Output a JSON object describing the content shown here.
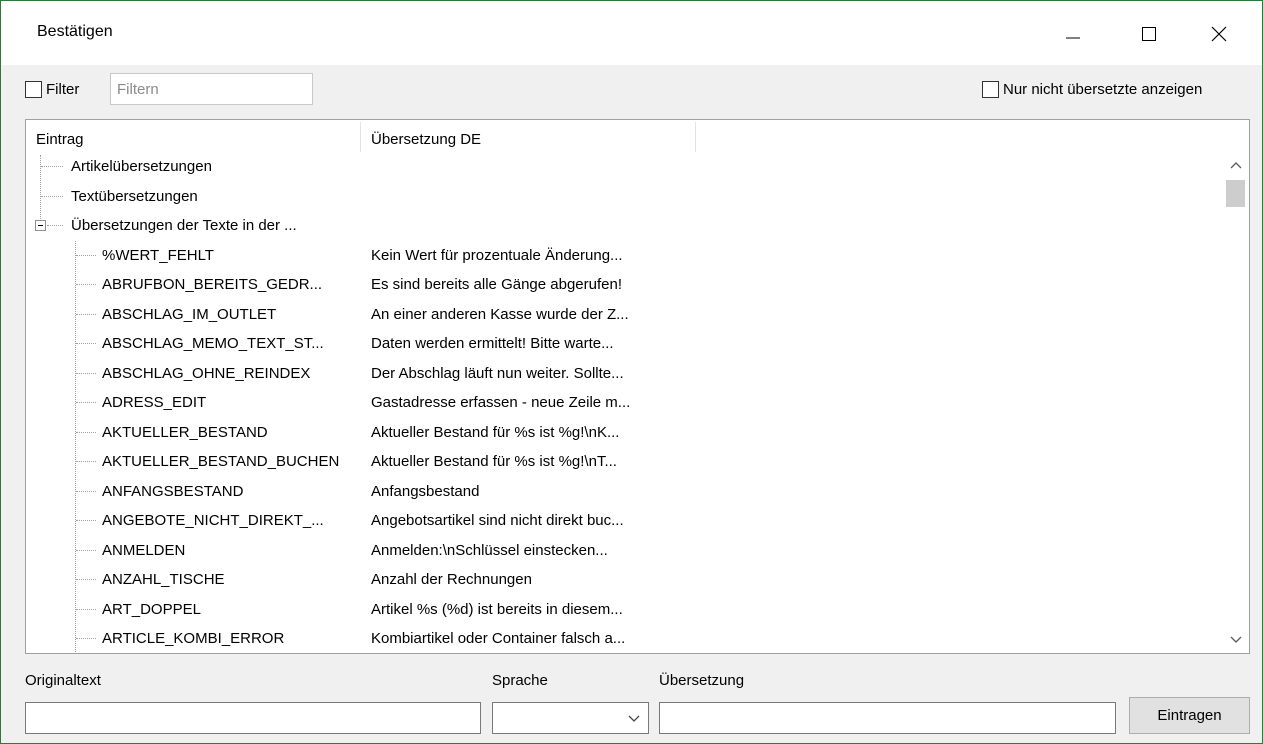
{
  "window": {
    "title": "Bestätigen"
  },
  "filter": {
    "checkbox_label": "Filter",
    "input_placeholder": "Filtern",
    "input_value": "",
    "untranslated_label": "Nur nicht übersetzte anzeigen"
  },
  "tree": {
    "columns": [
      "Eintrag",
      "Übersetzung DE"
    ],
    "groups": [
      {
        "label": "Artikelübersetzungen"
      },
      {
        "label": "Textübersetzungen"
      },
      {
        "label": "Übersetzungen der Texte in der ...",
        "expanded": true
      }
    ],
    "entries": [
      {
        "key": "%WERT_FEHLT",
        "value": "Kein Wert für prozentuale Änderung..."
      },
      {
        "key": "ABRUFBON_BEREITS_GEDR...",
        "value": "Es sind bereits alle Gänge abgerufen!"
      },
      {
        "key": "ABSCHLAG_IM_OUTLET",
        "value": "An einer anderen Kasse wurde der Z..."
      },
      {
        "key": "ABSCHLAG_MEMO_TEXT_ST...",
        "value": "Daten werden ermittelt! Bitte warte..."
      },
      {
        "key": "ABSCHLAG_OHNE_REINDEX",
        "value": "Der Abschlag läuft nun weiter. Sollte..."
      },
      {
        "key": "ADRESS_EDIT",
        "value": "Gastadresse erfassen - neue Zeile m..."
      },
      {
        "key": "AKTUELLER_BESTAND",
        "value": "Aktueller Bestand für %s ist %g!\\nK..."
      },
      {
        "key": "AKTUELLER_BESTAND_BUCHEN",
        "value": "Aktueller Bestand für %s ist %g!\\nT..."
      },
      {
        "key": "ANFANGSBESTAND",
        "value": "Anfangsbestand"
      },
      {
        "key": "ANGEBOTE_NICHT_DIREKT_...",
        "value": "Angebotsartikel sind nicht direkt buc..."
      },
      {
        "key": "ANMELDEN",
        "value": "Anmelden:\\nSchlüssel einstecken..."
      },
      {
        "key": "ANZAHL_TISCHE",
        "value": "Anzahl der Rechnungen"
      },
      {
        "key": "ART_DOPPEL",
        "value": "Artikel %s (%d) ist bereits in diesem..."
      },
      {
        "key": "ARTICLE_KOMBI_ERROR",
        "value": "Kombiartikel oder Container falsch a..."
      }
    ]
  },
  "form": {
    "original_label": "Originaltext",
    "original_value": "",
    "language_label": "Sprache",
    "language_value": "",
    "translation_label": "Übersetzung",
    "translation_value": "",
    "submit_label": "Eintragen"
  },
  "icons": {
    "minimize": "minimize-icon",
    "maximize": "maximize-icon",
    "close": "close-icon",
    "scroll_up": "chevron-up-icon",
    "scroll_down": "chevron-down-icon",
    "combo": "chevron-down-icon",
    "collapse": "minus-box-icon"
  }
}
